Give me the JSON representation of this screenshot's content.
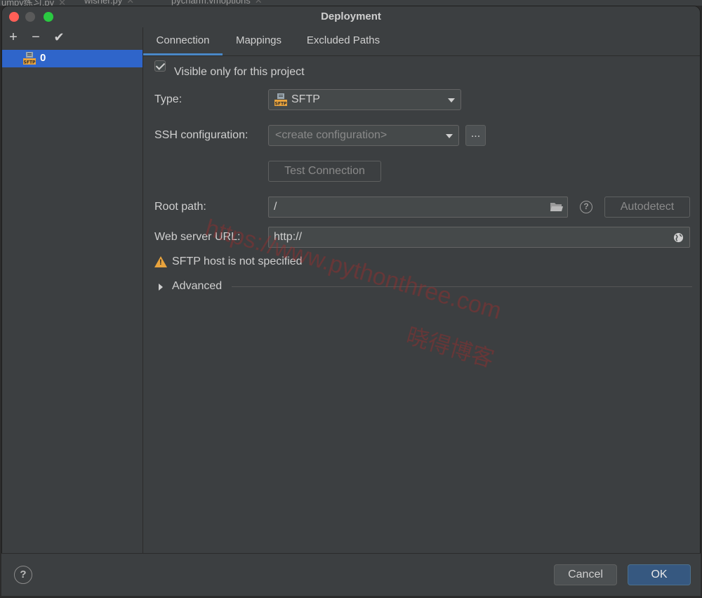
{
  "background_tabs": [
    {
      "label": "umpy练习.py"
    },
    {
      "label": "wisher.py"
    },
    {
      "label": "pycharm.vmoptions"
    }
  ],
  "window": {
    "title": "Deployment"
  },
  "toolbar": {
    "add": "+",
    "remove": "−",
    "apply": "✔"
  },
  "sidebar": {
    "servers": [
      {
        "label": "0",
        "icon": "sftp-icon"
      }
    ]
  },
  "tabs": [
    {
      "label": "Connection",
      "active": true
    },
    {
      "label": "Mappings",
      "active": false
    },
    {
      "label": "Excluded Paths",
      "active": false
    }
  ],
  "connection": {
    "visible_only_label": "Visible only for this project",
    "visible_only_checked": true,
    "type_label": "Type:",
    "type_value": "SFTP",
    "ssh_label": "SSH configuration:",
    "ssh_placeholder": "<create configuration>",
    "ssh_more": "...",
    "test_connection": "Test Connection",
    "root_path_label": "Root path:",
    "root_path_value": "/",
    "help_glyph": "?",
    "autodetect": "Autodetect",
    "web_url_label": "Web server URL:",
    "web_url_value": "http://",
    "warning_text": "SFTP host is not specified",
    "warning_glyph": "!",
    "advanced_label": "Advanced"
  },
  "watermark": {
    "url": "https://www.pythonthree.com",
    "cn": "晓得博客"
  },
  "footer": {
    "help": "?",
    "cancel": "Cancel",
    "ok": "OK"
  },
  "colors": {
    "accent": "#2f65ca",
    "tab_underline": "#4a88c7",
    "ok_button": "#365880",
    "warning": "#e8a33d"
  }
}
